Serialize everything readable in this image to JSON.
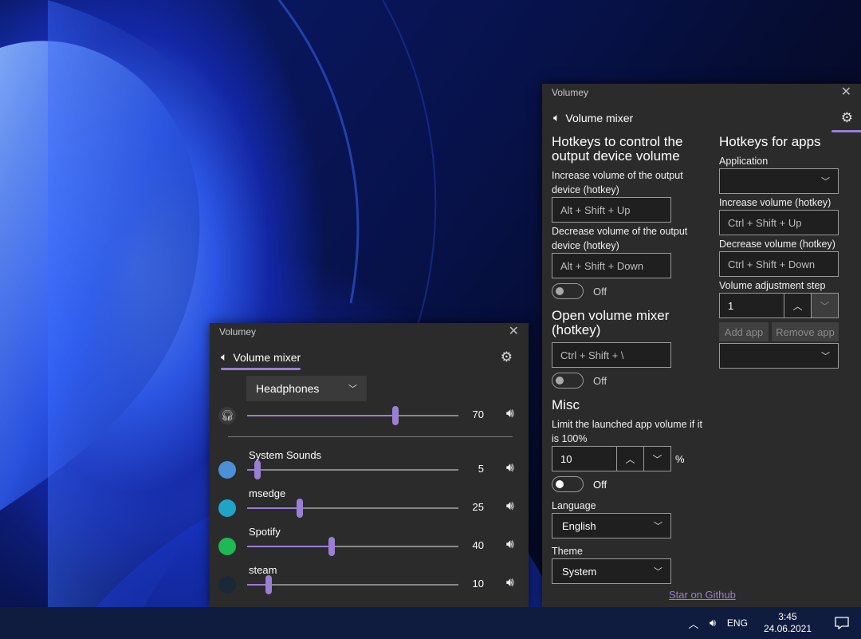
{
  "taskbar": {
    "lang": "ENG",
    "time": "3:45",
    "date": "24.06.2021",
    "icons": [
      "chevron-up-icon",
      "speaker-icon",
      "notification-icon"
    ]
  },
  "mixer": {
    "title": "Volumey",
    "tab_label": "Volume mixer",
    "device": "Headphones",
    "master": {
      "value": 70,
      "icon": "headphones-icon"
    },
    "apps": [
      {
        "name": "System Sounds",
        "value": 5,
        "icon": "system-sounds-icon",
        "color": "#4a8fd8"
      },
      {
        "name": "msedge",
        "value": 25,
        "icon": "edge-icon",
        "color": "#1fa4c8"
      },
      {
        "name": "Spotify",
        "value": 40,
        "icon": "spotify-icon",
        "color": "#1db954"
      },
      {
        "name": "steam",
        "value": 10,
        "icon": "steam-icon",
        "color": "#1b2838"
      }
    ]
  },
  "settings": {
    "title": "Volumey",
    "tab_label": "Volume mixer",
    "output": {
      "heading": "Hotkeys to control the output device volume",
      "increase_label": "Increase volume of the output device (hotkey)",
      "increase_placeholder": "Alt + Shift + Up",
      "decrease_label": "Decrease volume of the output device (hotkey)",
      "decrease_placeholder": "Alt + Shift + Down",
      "toggle_label": "Off"
    },
    "open_mixer": {
      "heading": "Open volume mixer (hotkey)",
      "placeholder": "Ctrl + Shift + \\",
      "toggle_label": "Off"
    },
    "misc": {
      "heading": "Misc",
      "limit_label": "Limit the launched app volume if it is 100%",
      "limit_value": "10",
      "unit": "%",
      "toggle_label": "Off",
      "language_label": "Language",
      "language_value": "English",
      "theme_label": "Theme",
      "theme_value": "System"
    },
    "apps": {
      "heading": "Hotkeys for apps",
      "application_label": "Application",
      "application_value": "",
      "increase_label": "Increase volume (hotkey)",
      "increase_placeholder": "Ctrl + Shift + Up",
      "decrease_label": "Decrease volume (hotkey)",
      "decrease_placeholder": "Ctrl + Shift + Down",
      "step_label": "Volume adjustment step",
      "step_value": "1",
      "add_label": "Add app",
      "remove_label": "Remove app",
      "list_value": ""
    },
    "github_link": "Star on Github"
  },
  "colors": {
    "accent": "#9b7fd4",
    "window_bg": "#2b2b2b",
    "taskbar_bg": "#101c3f"
  }
}
